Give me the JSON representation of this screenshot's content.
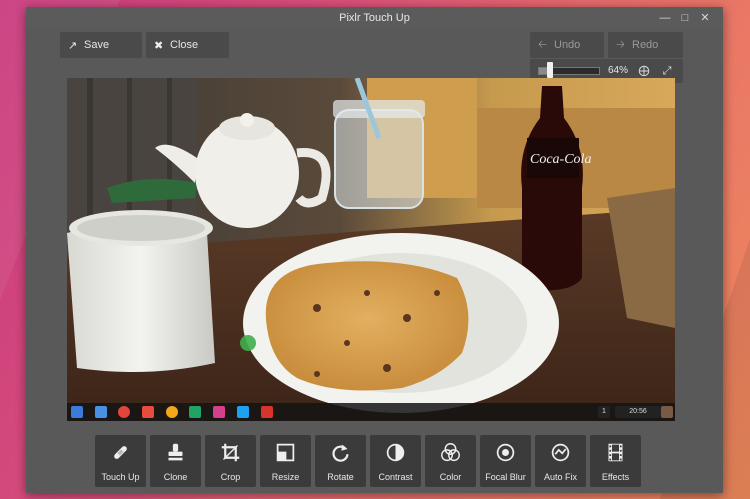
{
  "window": {
    "title": "Pixlr Touch Up"
  },
  "top_buttons": {
    "save": {
      "label": "Save",
      "icon": "share-icon"
    },
    "close": {
      "label": "Close",
      "icon": "close-icon"
    },
    "undo": {
      "label": "Undo",
      "icon": "arrow-left-icon"
    },
    "redo": {
      "label": "Redo",
      "icon": "arrow-right-icon"
    }
  },
  "zoom": {
    "value_label": "64%",
    "level": 0.2
  },
  "photo": {
    "bottle_text": "Coca-Cola",
    "tray": {
      "badge": "1",
      "time": "20:56"
    }
  },
  "tools": [
    {
      "label": "Touch Up",
      "icon": "bandage-icon"
    },
    {
      "label": "Clone",
      "icon": "stamp-icon"
    },
    {
      "label": "Crop",
      "icon": "crop-icon"
    },
    {
      "label": "Resize",
      "icon": "resize-icon"
    },
    {
      "label": "Rotate",
      "icon": "rotate-icon"
    },
    {
      "label": "Contrast",
      "icon": "contrast-icon"
    },
    {
      "label": "Color",
      "icon": "color-circles-icon"
    },
    {
      "label": "Focal Blur",
      "icon": "focal-blur-icon"
    },
    {
      "label": "Auto Fix",
      "icon": "auto-fix-icon"
    },
    {
      "label": "Effects",
      "icon": "film-icon"
    }
  ],
  "colors": {
    "window_bg": "#595959",
    "button_bg": "#4a4a4a",
    "tool_bg": "#3b3b3b",
    "text": "#e8e8e8"
  }
}
